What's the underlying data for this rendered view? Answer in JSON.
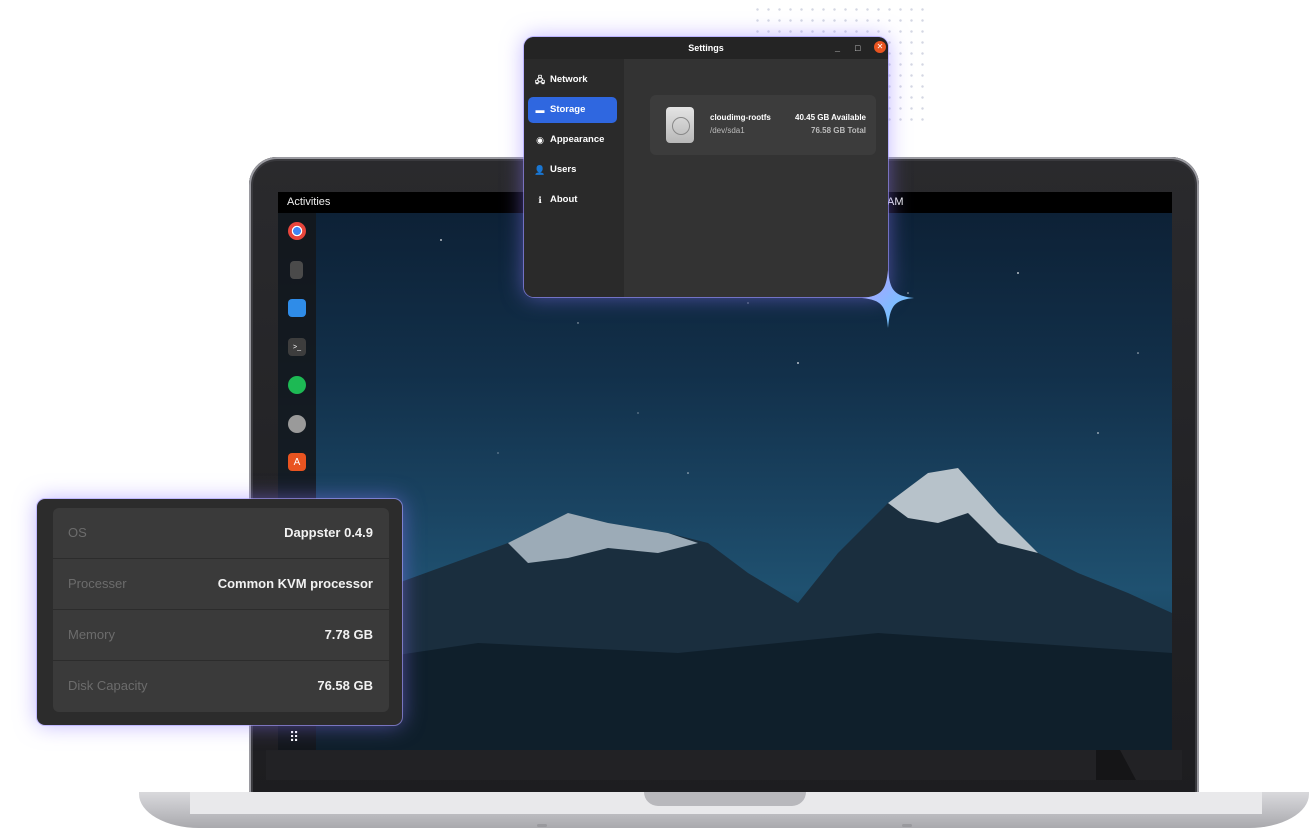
{
  "topbar": {
    "activities": "Activities",
    "clock_fragment": "AM"
  },
  "dock": {
    "items": [
      {
        "name": "chrome-icon",
        "color": "#e8453c"
      },
      {
        "name": "calculator-icon",
        "color": "#555555"
      },
      {
        "name": "vscode-icon",
        "color": "#2f8ce8"
      },
      {
        "name": "terminal-icon",
        "color": "#444444"
      },
      {
        "name": "spotify-icon",
        "color": "#1db954"
      },
      {
        "name": "settings-icon",
        "color": "#8a8a8a"
      },
      {
        "name": "software-store-icon",
        "color": "#e95420"
      }
    ],
    "apps_grid_glyph": "⠿"
  },
  "settings_window": {
    "title": "Settings",
    "minimize": "_",
    "maximize": "□",
    "close": "✕",
    "nav": [
      {
        "label": "Network",
        "icon": "🖧"
      },
      {
        "label": "Storage",
        "icon": "▬",
        "active": true
      },
      {
        "label": "Appearance",
        "icon": "◉"
      },
      {
        "label": "Users",
        "icon": "👤"
      },
      {
        "label": "About",
        "icon": "ℹ"
      }
    ],
    "disk": {
      "name": "cloudimg-rootfs",
      "device": "/dev/sda1",
      "available": "40.45 GB Available",
      "total": "76.58 GB Total"
    },
    "accent": "#2f67e0"
  },
  "system_info": {
    "rows": [
      {
        "label": "OS",
        "value": "Dappster 0.4.9"
      },
      {
        "label": "Processer",
        "value": "Common KVM processor"
      },
      {
        "label": "Memory",
        "value": "7.78 GB"
      },
      {
        "label": "Disk Capacity",
        "value": "76.58 GB"
      }
    ]
  }
}
